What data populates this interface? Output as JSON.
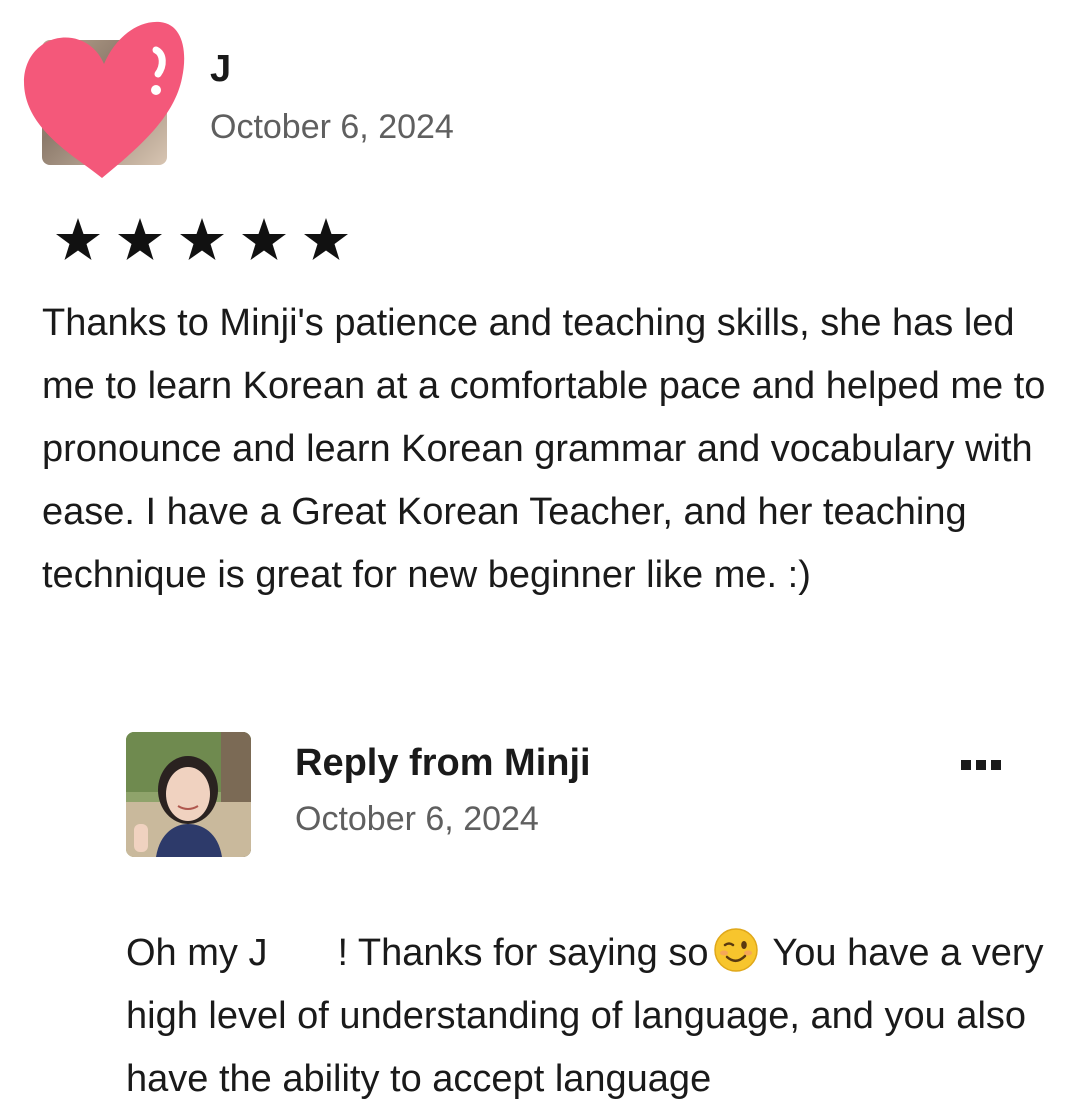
{
  "review": {
    "reviewer_name": "J",
    "date": "October 6, 2024",
    "rating": 5,
    "rating_max": 5,
    "text": "Thanks to Minji's patience and teaching skills, she has led me to learn Korean at a comfortable pace and helped me to pronounce and learn Korean grammar and vocabulary with ease. I have a Great Korean Teacher, and her teaching technique is great for new beginner like me. :)",
    "avatar_overlay_icon": "heart-sticker-icon"
  },
  "reply": {
    "title": "Reply from Minji",
    "date": "October 6, 2024",
    "text_part1": "Oh my J",
    "text_part2": "! Thanks for saying so",
    "text_part3": " You have a very high level of understanding of language, and you also have the ability to accept language",
    "emoji_icon": "winking-face-icon",
    "more_icon": "more-options-icon"
  },
  "colors": {
    "star": "#111111",
    "heart": "#f4587a",
    "secondary_text": "#5f5f5f"
  }
}
